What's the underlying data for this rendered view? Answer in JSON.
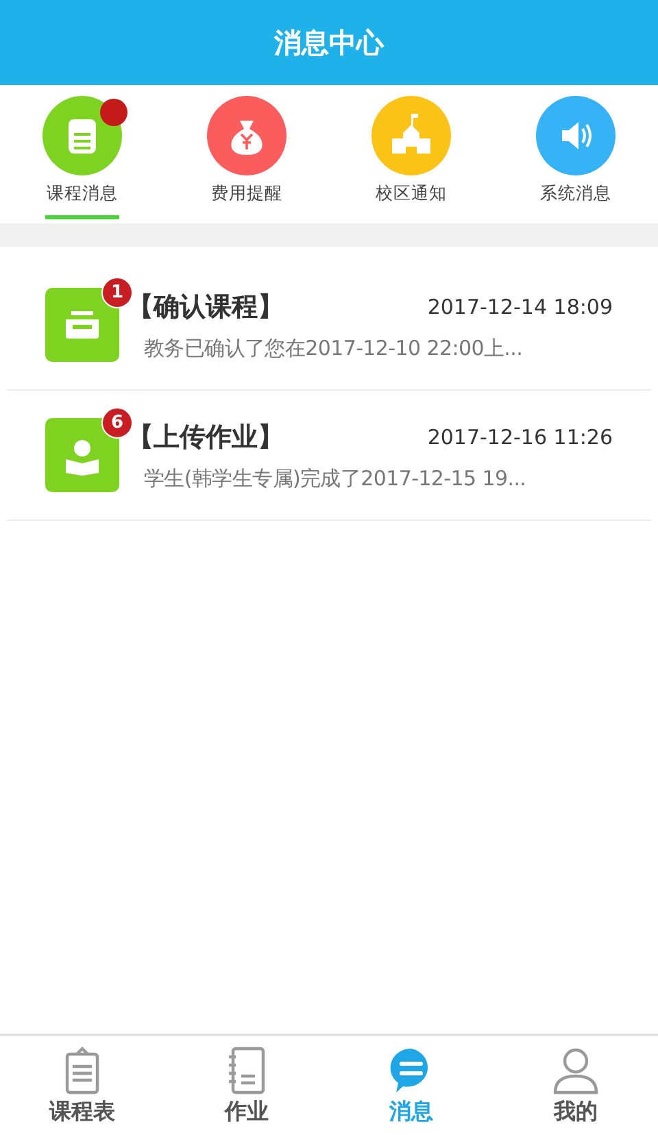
{
  "header": {
    "title": "消息中心"
  },
  "categories": [
    {
      "kind": "course",
      "label": "课程消息",
      "color": "#7ed321",
      "dot": true,
      "selected": true
    },
    {
      "kind": "fee",
      "label": "费用提醒",
      "color": "#fb5c5c",
      "dot": false,
      "selected": false
    },
    {
      "kind": "campus",
      "label": "校区通知",
      "color": "#fbc316",
      "dot": false,
      "selected": false
    },
    {
      "kind": "system",
      "label": "系统消息",
      "color": "#35b3f6",
      "dot": false,
      "selected": false
    }
  ],
  "messages": [
    {
      "kind": "inbox",
      "badge": "1",
      "title": "【确认课程】",
      "time": "2017-12-14 18:09",
      "preview": "教务已确认了您在2017-12-10 22:00上..."
    },
    {
      "kind": "reading",
      "badge": "6",
      "title": "【上传作业】",
      "time": "2017-12-16 11:26",
      "preview": "学生(韩学生专属)完成了2017-12-15 19..."
    }
  ],
  "nav": [
    {
      "kind": "schedule",
      "label": "课程表",
      "selected": false
    },
    {
      "kind": "homework",
      "label": "作业",
      "selected": false
    },
    {
      "kind": "messages",
      "label": "消息",
      "selected": true
    },
    {
      "kind": "me",
      "label": "我的",
      "selected": false
    }
  ]
}
